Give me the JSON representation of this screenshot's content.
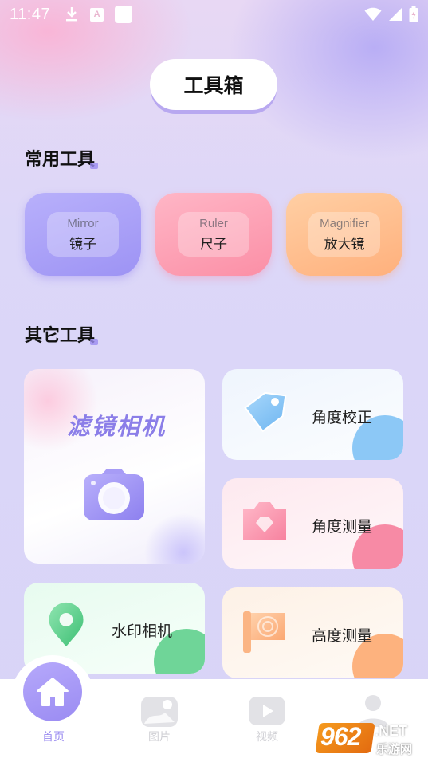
{
  "status_bar": {
    "time": "11:47",
    "icons": [
      "download-icon",
      "a-icon",
      "square-icon",
      "wifi-icon",
      "signal-icon",
      "battery-icon"
    ]
  },
  "header": {
    "title": "工具箱"
  },
  "common_tools": {
    "title": "常用工具",
    "items": [
      {
        "en": "Mirror",
        "cn": "镜子",
        "color": "#a79ef7"
      },
      {
        "en": "Ruler",
        "cn": "尺子",
        "color": "#fd9db2"
      },
      {
        "en": "Magnifier",
        "cn": "放大镜",
        "color": "#ffbd8c"
      }
    ]
  },
  "other_tools": {
    "title": "其它工具",
    "filter_camera": {
      "label": "滤镜相机",
      "icon": "camera-icon"
    },
    "items": [
      {
        "label": "角度校正",
        "icon": "tag-icon",
        "accent": "#8cc8f6"
      },
      {
        "label": "角度测量",
        "icon": "protractor-icon",
        "accent": "#f78aa5"
      },
      {
        "label": "水印相机",
        "icon": "location-pin-icon",
        "accent": "#6fd598"
      },
      {
        "label": "高度测量",
        "icon": "flag-icon",
        "accent": "#fdb27e"
      }
    ]
  },
  "bottom_nav": {
    "items": [
      {
        "label": "首页",
        "icon": "home-icon",
        "active": true
      },
      {
        "label": "图片",
        "icon": "image-icon",
        "active": false
      },
      {
        "label": "视频",
        "icon": "video-icon",
        "active": false
      },
      {
        "label": "",
        "icon": "user-icon",
        "active": false
      }
    ]
  },
  "watermark": {
    "number": "962",
    "suffix": ".NET",
    "cn": "乐游网"
  },
  "colors": {
    "accent": "#9b8cf0",
    "background": "#d9d5f7"
  }
}
